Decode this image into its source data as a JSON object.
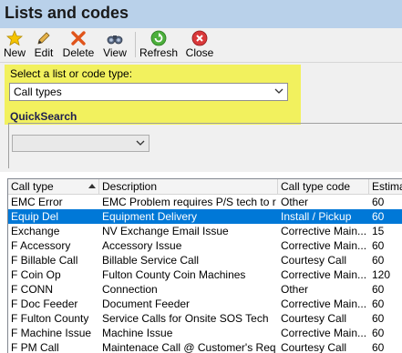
{
  "window": {
    "title": "Lists and codes"
  },
  "toolbar": {
    "buttons": [
      {
        "label": "New",
        "icon": "star-icon"
      },
      {
        "label": "Edit",
        "icon": "pencil-icon"
      },
      {
        "label": "Delete",
        "icon": "delete-x-icon"
      },
      {
        "label": "View",
        "icon": "binoculars-icon"
      },
      {
        "label": "Refresh",
        "icon": "refresh-icon"
      },
      {
        "label": "Close",
        "icon": "close-icon"
      }
    ]
  },
  "selector": {
    "label": "Select a list or code type:",
    "value": "Call types"
  },
  "quicksearch": {
    "title": "QuickSearch",
    "value": ""
  },
  "grid": {
    "columns": [
      "Call type",
      "Description",
      "Call type code",
      "Estimat"
    ],
    "sorted_column": "Call type",
    "rows": [
      {
        "type": "EMC Error",
        "desc": "EMC Problem requires P/S tech to r...",
        "code": "Other",
        "est": "60",
        "selected": false
      },
      {
        "type": "Equip Del",
        "desc": "Equipment Delivery",
        "code": "Install / Pickup",
        "est": "60",
        "selected": true
      },
      {
        "type": "Exchange",
        "desc": "NV Exchange Email Issue",
        "code": "Corrective Main...",
        "est": "15",
        "selected": false
      },
      {
        "type": "F Accessory",
        "desc": "Accessory Issue",
        "code": "Corrective Main...",
        "est": "60",
        "selected": false
      },
      {
        "type": "F Billable Call",
        "desc": "Billable Service Call",
        "code": "Courtesy Call",
        "est": "60",
        "selected": false
      },
      {
        "type": "F Coin Op",
        "desc": "Fulton County Coin Machines",
        "code": "Corrective Main...",
        "est": "120",
        "selected": false
      },
      {
        "type": "F CONN",
        "desc": "Connection",
        "code": "Other",
        "est": "60",
        "selected": false
      },
      {
        "type": "F Doc Feeder",
        "desc": "Document Feeder",
        "code": "Corrective Main...",
        "est": "60",
        "selected": false
      },
      {
        "type": "F Fulton County",
        "desc": "Service Calls for Onsite SOS Tech",
        "code": "Courtesy Call",
        "est": "60",
        "selected": false
      },
      {
        "type": "F Machine Issue",
        "desc": "Machine Issue",
        "code": "Corrective Main...",
        "est": "60",
        "selected": false
      },
      {
        "type": "F PM Call",
        "desc": "Maintenace Call @ Customer's Requ...",
        "code": "Courtesy Call",
        "est": "60",
        "selected": false
      }
    ]
  },
  "colors": {
    "titlebar": "#b9d1ea",
    "highlight": "#f2f15e",
    "selection": "#0078d7"
  }
}
